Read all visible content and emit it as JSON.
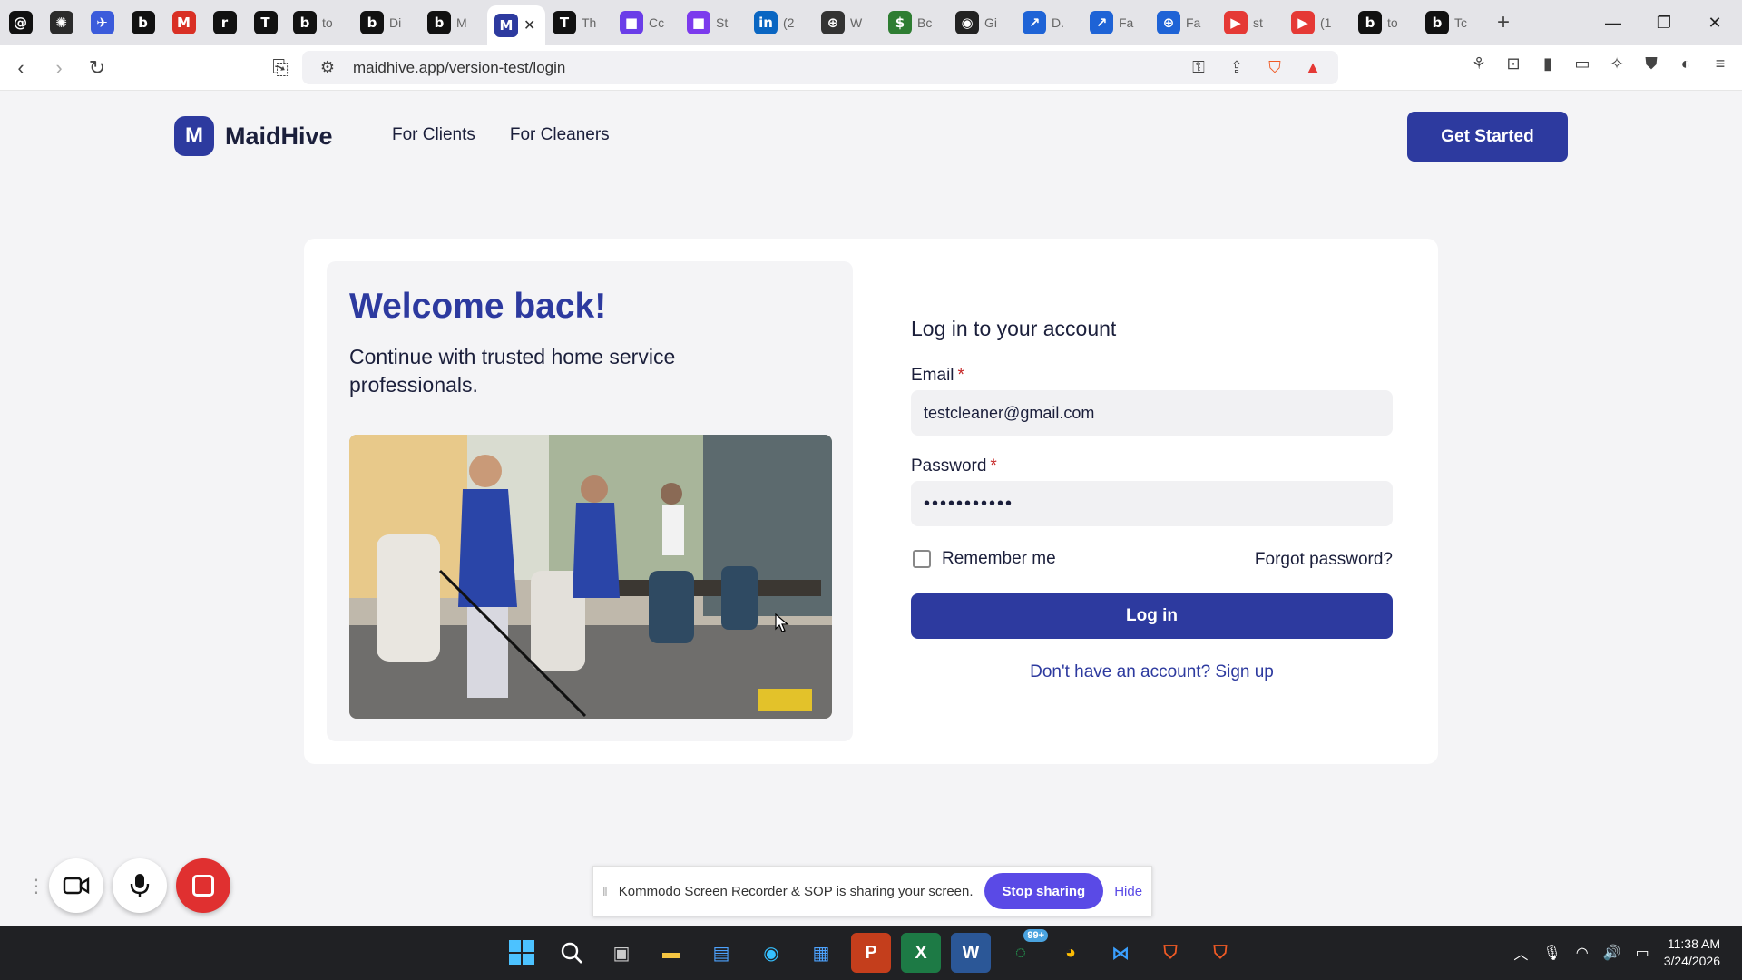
{
  "browser": {
    "tabs": [
      {
        "label": "",
        "icon": "threads-icon",
        "color": "#111111",
        "glyph": "@",
        "pinned": true
      },
      {
        "label": "",
        "icon": "openai-icon",
        "color": "#2b2b2b",
        "glyph": "✺",
        "pinned": true
      },
      {
        "label": "",
        "icon": "bird-icon",
        "color": "#3b5bdb",
        "glyph": "✈",
        "pinned": true
      },
      {
        "label": "",
        "icon": "bubble-icon",
        "color": "#111111",
        "glyph": "b",
        "pinned": true
      },
      {
        "label": "",
        "icon": "gmail-icon",
        "color": "#d93025",
        "glyph": "M",
        "pinned": true
      },
      {
        "label": "",
        "icon": "notion-icon",
        "color": "#111111",
        "glyph": "r",
        "pinned": true
      },
      {
        "label": "",
        "icon": "typing-icon",
        "color": "#111111",
        "glyph": "T",
        "pinned": true
      },
      {
        "label": "to",
        "icon": "bubble-icon",
        "color": "#111111",
        "glyph": "b"
      },
      {
        "label": "Di",
        "icon": "bubble-icon",
        "color": "#111111",
        "glyph": "b"
      },
      {
        "label": "M",
        "icon": "bubble-icon",
        "color": "#111111",
        "glyph": "b"
      },
      {
        "label": "",
        "icon": "maidhive-icon",
        "color": "#2d3a9f",
        "glyph": "M",
        "active": true
      },
      {
        "label": "Th",
        "icon": "notion-icon",
        "color": "#111111",
        "glyph": "T"
      },
      {
        "label": "Cc",
        "icon": "square-icon",
        "color": "#6a3de8",
        "glyph": "■"
      },
      {
        "label": "St",
        "icon": "square-icon",
        "color": "#7c3aed",
        "glyph": "■"
      },
      {
        "label": "(2",
        "icon": "linkedin-icon",
        "color": "#0a66c2",
        "glyph": "in"
      },
      {
        "label": "W",
        "icon": "globe-icon",
        "color": "#333333",
        "glyph": "⊕"
      },
      {
        "label": "Bc",
        "icon": "dollar-icon",
        "color": "#2e7d32",
        "glyph": "$"
      },
      {
        "label": "Gi",
        "icon": "github-icon",
        "color": "#222222",
        "glyph": "◉"
      },
      {
        "label": "D.",
        "icon": "link-icon",
        "color": "#1e63d6",
        "glyph": "↗"
      },
      {
        "label": "Fa",
        "icon": "link-icon",
        "color": "#1e63d6",
        "glyph": "↗"
      },
      {
        "label": "Fa",
        "icon": "globe-icon",
        "color": "#1e63d6",
        "glyph": "⊕"
      },
      {
        "label": "st",
        "icon": "youtube-icon",
        "color": "#e53935",
        "glyph": "▶"
      },
      {
        "label": "(1",
        "icon": "youtube-icon",
        "color": "#e53935",
        "glyph": "▶"
      },
      {
        "label": "to",
        "icon": "bubble-icon",
        "color": "#111111",
        "glyph": "b"
      },
      {
        "label": "Tc",
        "icon": "bubble-icon",
        "color": "#111111",
        "glyph": "b"
      }
    ],
    "url": "maidhive.app/version-test/login"
  },
  "site": {
    "logo_letter": "M",
    "brand": "MaidHive",
    "nav": [
      "For Clients",
      "For Cleaners"
    ],
    "cta": "Get Started"
  },
  "left": {
    "welcome": "Welcome back!",
    "tagline": "Continue with trusted home service professionals."
  },
  "form": {
    "title": "Log in to your account",
    "email_label": "Email",
    "email_value": "testcleaner@gmail.com",
    "password_label": "Password",
    "password_value": "•••••••••••",
    "required_mark": "*",
    "remember": "Remember me",
    "forgot": "Forgot password?",
    "login": "Log in",
    "signup": "Don't have an account? Sign up"
  },
  "recorder": {
    "share_text": "Kommodo Screen Recorder & SOP is sharing your screen.",
    "stop": "Stop sharing",
    "hide": "Hide"
  },
  "taskbar": {
    "badge": "99+",
    "time": "11:38 AM",
    "date": "3/24/2026"
  },
  "colors": {
    "brand": "#2d3a9f",
    "page_bg": "#f4f4f6",
    "share_accent": "#5a4ae6"
  }
}
